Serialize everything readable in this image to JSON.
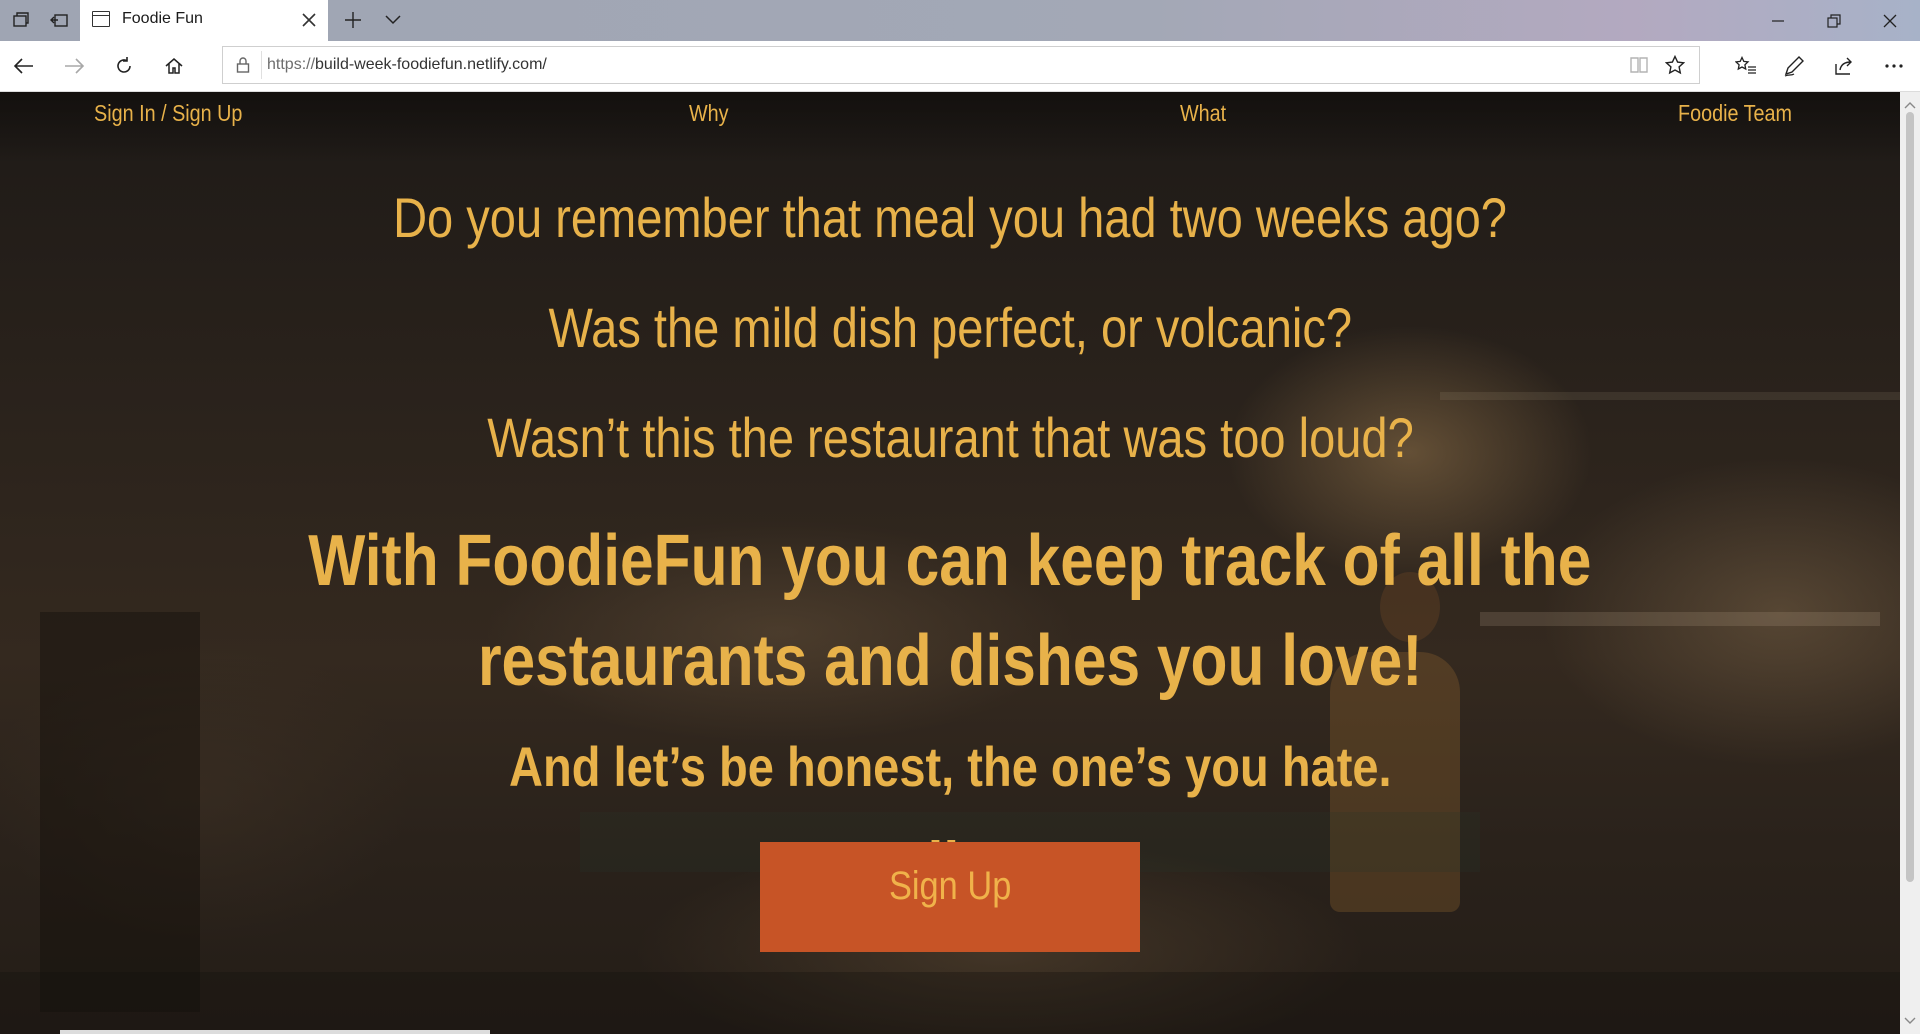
{
  "browser": {
    "tab": {
      "title": "Foodie Fun"
    },
    "address": {
      "url_scheme": "https://",
      "url_rest": "build-week-foodiefun.netlify.com/"
    },
    "icons": {
      "tab_set_aside": "tabs-aside-icon",
      "tab_restore": "tabs-restore-icon",
      "tab": "page-icon",
      "close": "close-icon",
      "new_tab": "plus-icon",
      "tab_list": "chevron-down-icon",
      "minimize": "minimize-icon",
      "maximize": "restore-window-icon",
      "window_close": "close-icon",
      "back": "back-arrow-icon",
      "forward": "forward-arrow-icon",
      "refresh": "refresh-icon",
      "home": "home-icon",
      "lock": "lock-icon",
      "reading_view": "reading-view-icon",
      "favorite": "star-icon",
      "favorites": "favorites-list-icon",
      "notes": "pen-icon",
      "share": "share-icon",
      "more": "more-icon"
    }
  },
  "site": {
    "nav": {
      "signin": "Sign In / Sign Up",
      "why": "Why",
      "what": "What",
      "team": "Foodie Team"
    },
    "hero": {
      "q1": "Do you remember that meal you had two weeks ago?",
      "q2": "Was the mild dish perfect, or volcanic?",
      "q3": "Wasn’t this the restaurant that was too loud?",
      "pitch1": "With FoodieFun you can keep track of all the",
      "pitch2": "restaurants and dishes you love!",
      "pitch3": "And let’s be honest, the one’s you hate.",
      "brand": "FoodieFun",
      "cta": "Sign Up"
    },
    "colors": {
      "accent": "#e8b24a",
      "button": "#c75426",
      "background": "#2b231c"
    }
  }
}
